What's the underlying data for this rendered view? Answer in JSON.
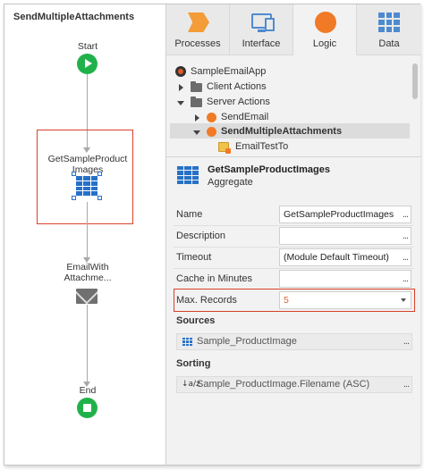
{
  "flow": {
    "title": "SendMultipleAttachments",
    "start_label": "Start",
    "aggregate_label": "GetSampleProduct\nImages",
    "aggregate_label_line1": "GetSampleProduct",
    "aggregate_label_line2": "Images",
    "email_label_line1": "EmailWith",
    "email_label_line2": "Attachme...",
    "end_label": "End"
  },
  "tabs": [
    {
      "label": "Processes",
      "icon": "processes-icon",
      "active": false
    },
    {
      "label": "Interface",
      "icon": "interface-icon",
      "active": false
    },
    {
      "label": "Logic",
      "icon": "logic-icon",
      "active": true
    },
    {
      "label": "Data",
      "icon": "data-icon",
      "active": false
    }
  ],
  "tree": {
    "app": "SampleEmailApp",
    "client_actions": "Client Actions",
    "server_actions": "Server Actions",
    "send_email": "SendEmail",
    "send_multiple": "SendMultipleAttachments",
    "email_test_to": "EmailTestTo"
  },
  "element": {
    "name": "GetSampleProductImages",
    "type": "Aggregate"
  },
  "properties": {
    "name_label": "Name",
    "name_value": "GetSampleProductImages",
    "description_label": "Description",
    "description_value": "",
    "timeout_label": "Timeout",
    "timeout_value": "(Module Default Timeout)",
    "cache_label": "Cache in Minutes",
    "cache_value": "",
    "maxrecords_label": "Max. Records",
    "maxrecords_value": "5",
    "more": "..."
  },
  "sources": {
    "title": "Sources",
    "item": "Sample_ProductImage"
  },
  "sorting": {
    "title": "Sorting",
    "item": "Sample_ProductImage.Filename (ASC)",
    "sort_icon_text": "↓a/z"
  },
  "colors": {
    "accent_orange": "#f07a26",
    "flow_green": "#21b14b",
    "aggregate_blue": "#2671c8",
    "highlight_red": "#d9412a"
  }
}
